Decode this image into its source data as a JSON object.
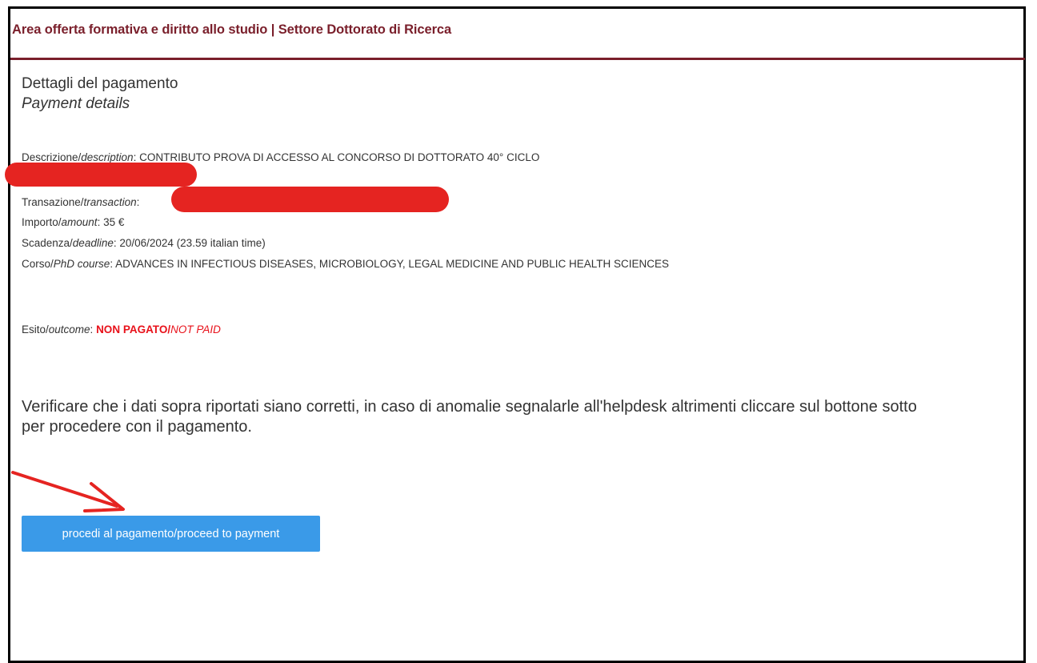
{
  "header": {
    "title": "Area offerta formativa e diritto allo studio | Settore Dottorato di Ricerca"
  },
  "page": {
    "title_it": "Dettagli del pagamento",
    "title_en": "Payment details"
  },
  "details": {
    "description": {
      "label_it": "Descrizione/",
      "label_en": "description",
      "sep": ": ",
      "value": "CONTRIBUTO PROVA DI ACCESSO AL CONCORSO DI DOTTORATO 40° CICLO"
    },
    "transaction": {
      "label_it": "Transazione/",
      "label_en": "transaction",
      "sep": ": ",
      "value": ""
    },
    "amount": {
      "label_it": "Importo/",
      "label_en": "amount",
      "sep": ": ",
      "value": "35 €"
    },
    "deadline": {
      "label_it": "Scadenza/",
      "label_en": "deadline",
      "sep": ": ",
      "value": "20/06/2024 (23.59 italian time)"
    },
    "course": {
      "label_it": "Corso/",
      "label_en": "PhD course",
      "sep": ": ",
      "value": "ADVANCES IN INFECTIOUS DISEASES, MICROBIOLOGY, LEGAL MEDICINE AND PUBLIC HEALTH SCIENCES"
    },
    "outcome": {
      "label_it": "Esito/",
      "label_en": "outcome",
      "sep": ": ",
      "status_it": "NON PAGATO",
      "status_sep": "/",
      "status_en": "NOT PAID"
    }
  },
  "notice": {
    "text": "Verificare che i dati sopra riportati siano corretti, in caso di anomalie segnalarle all'helpdesk altrimenti cliccare sul bottone sotto per procedere con il pagamento."
  },
  "actions": {
    "pay_button_label": "procedi al pagamento/proceed to payment"
  },
  "colors": {
    "header": "#7a1f2b",
    "status": "#e8111a",
    "button": "#3a9ae8",
    "redaction": "#e52421"
  },
  "icons": {
    "annotation_arrow": "arrow-icon"
  }
}
